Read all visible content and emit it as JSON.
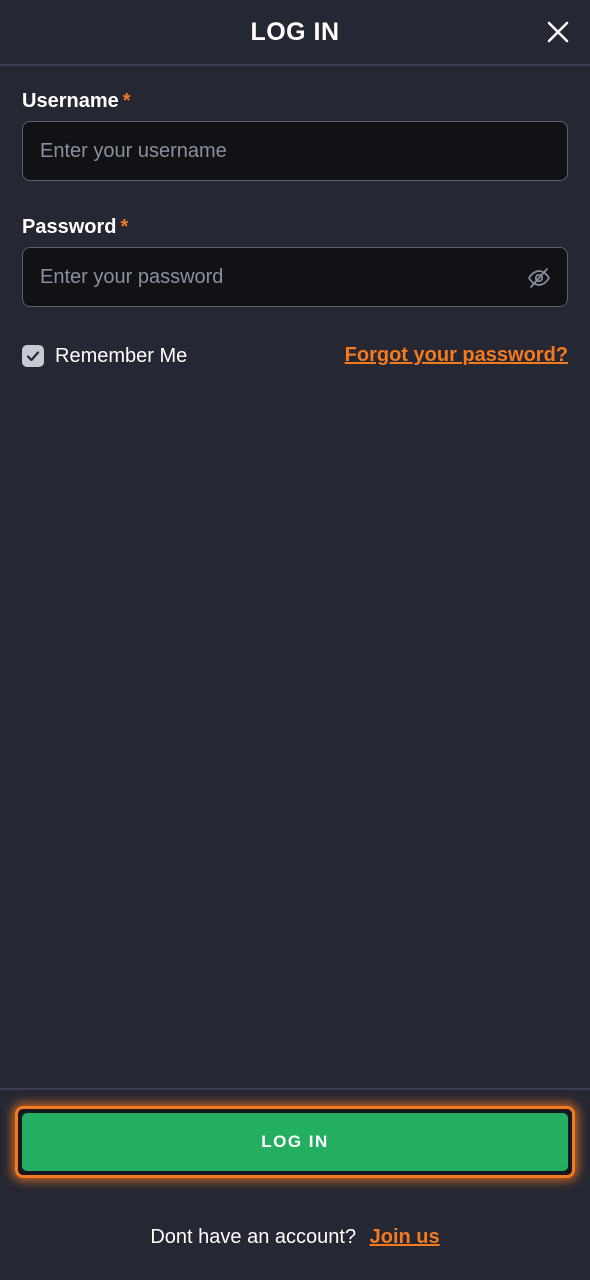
{
  "header": {
    "title": "LOG IN",
    "close_icon": "close-icon"
  },
  "form": {
    "username": {
      "label": "Username",
      "required_mark": "*",
      "placeholder": "Enter your username",
      "value": ""
    },
    "password": {
      "label": "Password",
      "required_mark": "*",
      "placeholder": "Enter your password",
      "value": "",
      "toggle_icon": "eye-off-icon"
    },
    "remember": {
      "label": "Remember Me",
      "checked": true,
      "check_icon": "check-icon"
    },
    "forgot_link": "Forgot your password?"
  },
  "footer": {
    "login_button": "LOG IN",
    "signup_prompt": "Dont have an account?",
    "join_link": "Join us"
  },
  "colors": {
    "background": "#252733",
    "accent": "#f47a1f",
    "primary": "#24ae62",
    "input_bg": "#111216"
  }
}
